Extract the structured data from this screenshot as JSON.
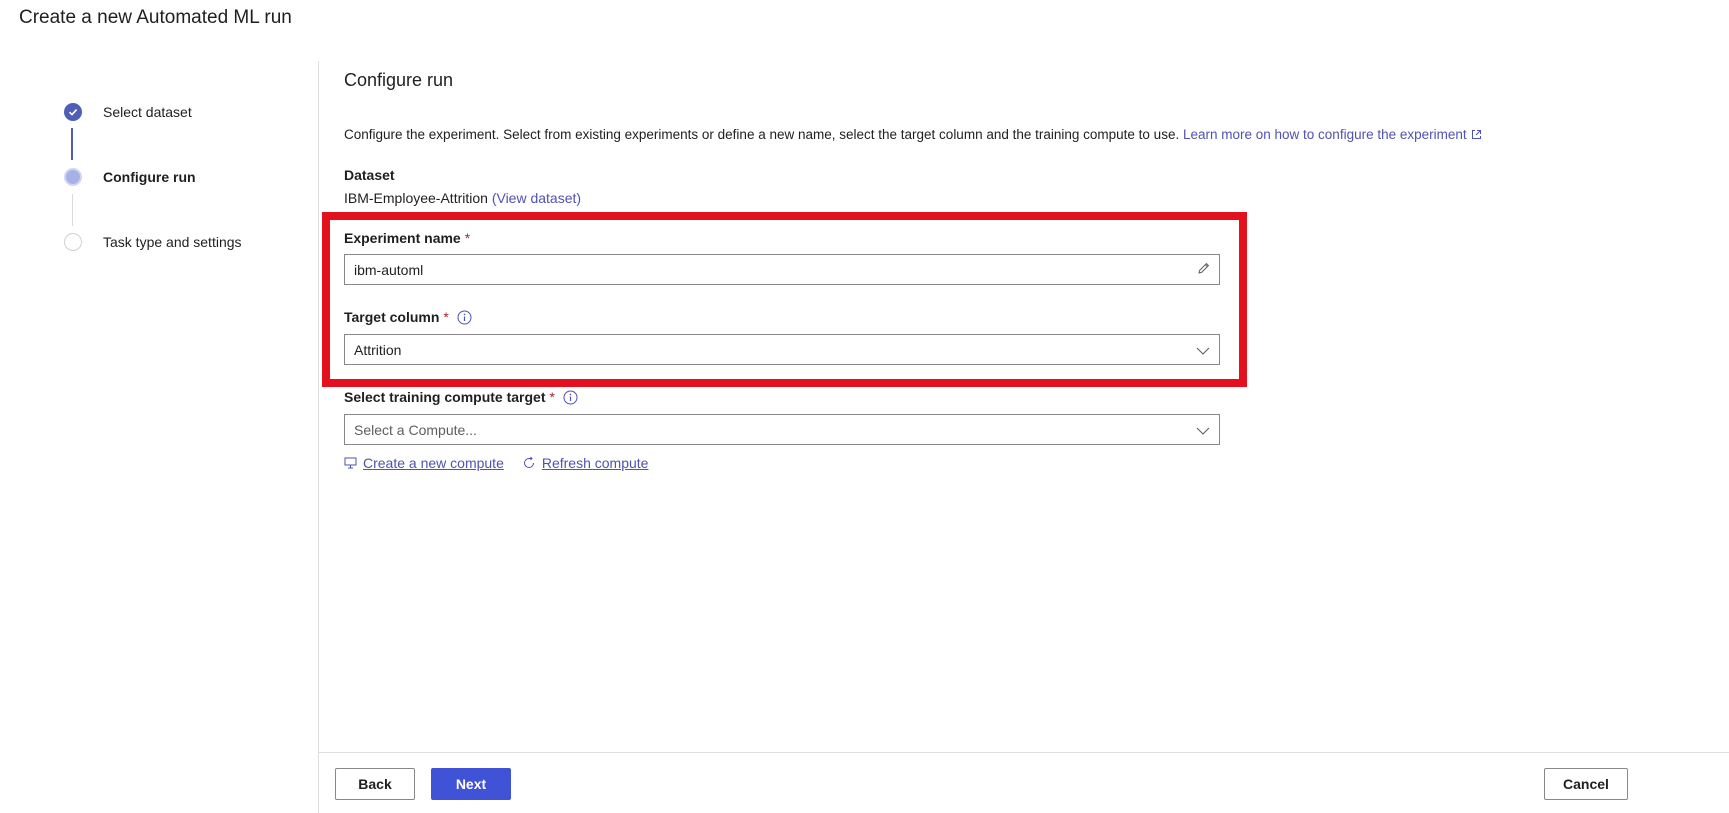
{
  "page": {
    "title": "Create a new Automated ML run"
  },
  "stepper": {
    "steps": [
      {
        "label": "Select dataset",
        "state": "done"
      },
      {
        "label": "Configure run",
        "state": "current"
      },
      {
        "label": "Task type and settings",
        "state": "pending"
      }
    ]
  },
  "main": {
    "title": "Configure run",
    "description": "Configure the experiment. Select from existing experiments or define a new name, select the target column and the training compute to use.",
    "learn_more_link": "Learn more on how to configure the experiment",
    "dataset": {
      "label": "Dataset",
      "name": "IBM-Employee-Attrition",
      "view_link": "(View dataset)"
    },
    "experiment_name": {
      "label": "Experiment name",
      "required_mark": "*",
      "value": "ibm-automl"
    },
    "target_column": {
      "label": "Target column",
      "required_mark": "*",
      "selected": "Attrition"
    },
    "compute_target": {
      "label": "Select training compute target",
      "required_mark": "*",
      "placeholder": "Select a Compute..."
    },
    "links": {
      "create_compute": "Create a new compute",
      "refresh_compute": "Refresh compute"
    }
  },
  "footer": {
    "back": "Back",
    "next": "Next",
    "cancel": "Cancel"
  },
  "colors": {
    "accent": "#4052d6",
    "link": "#4f52b2",
    "highlight": "#e3101e",
    "required": "#a4262c"
  }
}
